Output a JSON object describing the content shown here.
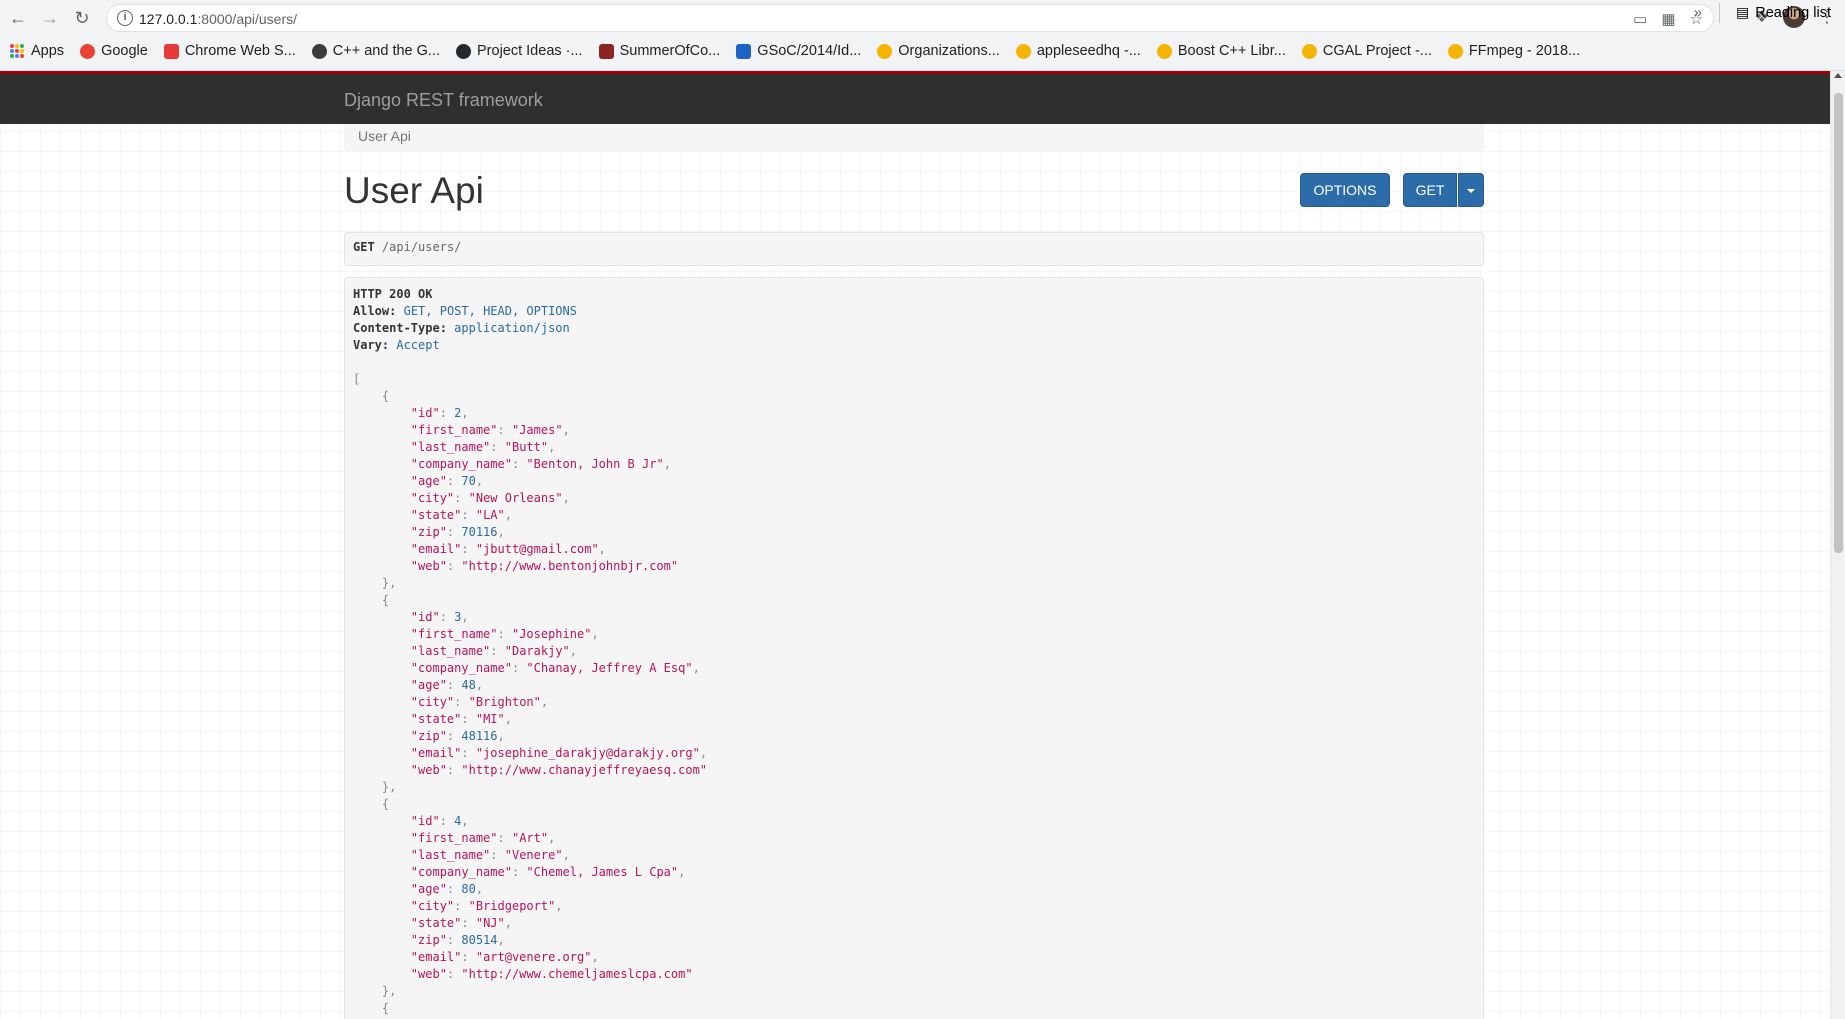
{
  "browser": {
    "url_host": "127.0.0.1",
    "url_rest": ":8000/api/users/",
    "bookmarks": [
      {
        "label": "Apps",
        "icon": "apps-grid-icon",
        "color": "#4285f4"
      },
      {
        "label": "Google",
        "icon": "google-icon",
        "color": "#ea4335"
      },
      {
        "label": "Chrome Web S...",
        "icon": "chrome-web-store-icon",
        "color": "#e53935"
      },
      {
        "label": "C++ and the G...",
        "icon": "globe-icon",
        "color": "#3c3c3c"
      },
      {
        "label": "Project Ideas ·...",
        "icon": "github-icon",
        "color": "#24292e"
      },
      {
        "label": "SummerOfCo...",
        "icon": "bug-icon",
        "color": "#8d2424"
      },
      {
        "label": "GSoC/2014/Id...",
        "icon": "kde-icon",
        "color": "#1d63c4"
      },
      {
        "label": "Organizations...",
        "icon": "gsoc-sun-icon",
        "color": "#f5b400"
      },
      {
        "label": "appleseedhq -...",
        "icon": "gsoc-sun-icon",
        "color": "#f5b400"
      },
      {
        "label": "Boost C++ Libr...",
        "icon": "gsoc-sun-icon",
        "color": "#f5b400"
      },
      {
        "label": "CGAL Project -...",
        "icon": "gsoc-sun-icon",
        "color": "#f5b400"
      },
      {
        "label": "FFmpeg - 2018...",
        "icon": "gsoc-sun-icon",
        "color": "#f5b400"
      }
    ],
    "more_label": "»",
    "reading_list_label": "Reading list"
  },
  "app": {
    "brand": "Django REST framework",
    "breadcrumb": "User Api",
    "title": "User Api",
    "options_label": "OPTIONS",
    "get_label": "GET"
  },
  "request": {
    "method": "GET",
    "path": "/api/users/"
  },
  "response": {
    "status": "HTTP 200 OK",
    "headers": [
      {
        "name": "Allow:",
        "value": "GET, POST, HEAD, OPTIONS"
      },
      {
        "name": "Content-Type:",
        "value": "application/json"
      },
      {
        "name": "Vary:",
        "value": "Accept"
      }
    ],
    "users": [
      {
        "id": 2,
        "first_name": "James",
        "last_name": "Butt",
        "company_name": "Benton, John B Jr",
        "age": 70,
        "city": "New Orleans",
        "state": "LA",
        "zip": 70116,
        "email": "jbutt@gmail.com",
        "web": "http://www.bentonjohnbjr.com"
      },
      {
        "id": 3,
        "first_name": "Josephine",
        "last_name": "Darakjy",
        "company_name": "Chanay, Jeffrey A Esq",
        "age": 48,
        "city": "Brighton",
        "state": "MI",
        "zip": 48116,
        "email": "josephine_darakjy@darakjy.org",
        "web": "http://www.chanayjeffreyaesq.com"
      },
      {
        "id": 4,
        "first_name": "Art",
        "last_name": "Venere",
        "company_name": "Chemel, James L Cpa",
        "age": 80,
        "city": "Bridgeport",
        "state": "NJ",
        "zip": 80514,
        "email": "art@venere.org",
        "web": "http://www.chemeljameslcpa.com"
      }
    ]
  }
}
